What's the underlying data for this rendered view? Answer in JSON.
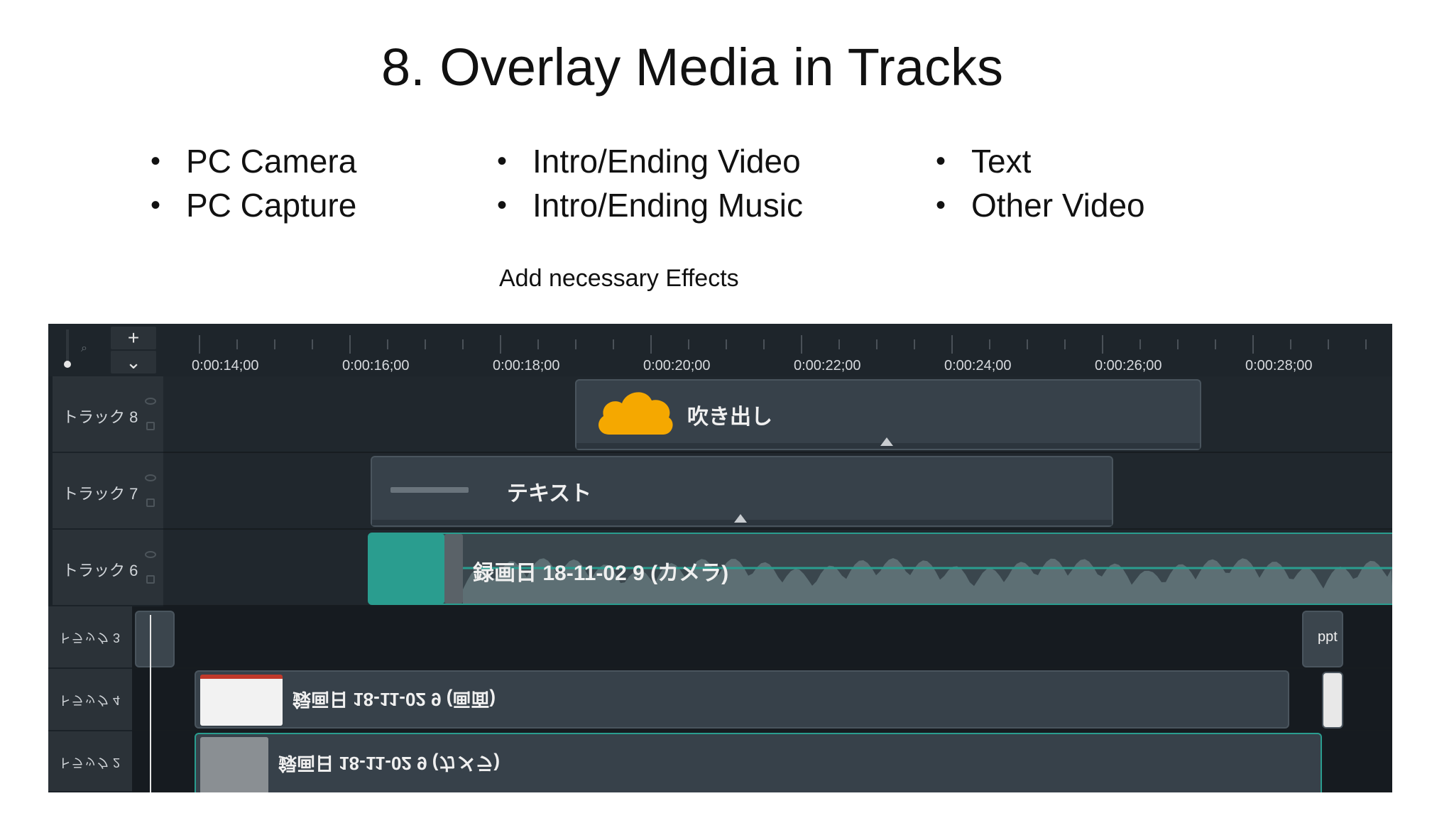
{
  "slide": {
    "title": "8. Overlay Media in Tracks",
    "bullets_col1": [
      "PC Camera",
      "PC Capture"
    ],
    "bullets_col2": [
      "Intro/Ending Video",
      "Intro/Ending Music"
    ],
    "bullets_col3": [
      "Text",
      "Other Video"
    ],
    "note": "Add necessary Effects"
  },
  "timeline": {
    "add_track_label": "+",
    "collapse_label": "⌄",
    "ruler_labels": [
      "0:00:14;00",
      "0:00:16;00",
      "0:00:18;00",
      "0:00:20;00",
      "0:00:22;00",
      "0:00:24;00",
      "0:00:26;00",
      "0:00:28;00"
    ],
    "tracks": [
      {
        "name": "トラック 8"
      },
      {
        "name": "トラック 7"
      },
      {
        "name": "トラック 6"
      },
      {
        "name": "トラック 3"
      },
      {
        "name": "トラック 4"
      },
      {
        "name": "トラック 2"
      }
    ],
    "clips": {
      "callout_label": "吹き出し",
      "text_label": "テキスト",
      "camera_label": "録画日 18-11-02 9 (カメラ)",
      "screen_label": "録画日 18-11-02 9 (画面)",
      "track2_label": "録画日 18-11-02 9 (カメラ)",
      "ppt_label": "ppt"
    }
  },
  "colors": {
    "editor_bg": "#1b2228",
    "clip_bg": "#37414a",
    "accent_teal": "#2a9d8f",
    "callout_yellow": "#f5a800"
  }
}
